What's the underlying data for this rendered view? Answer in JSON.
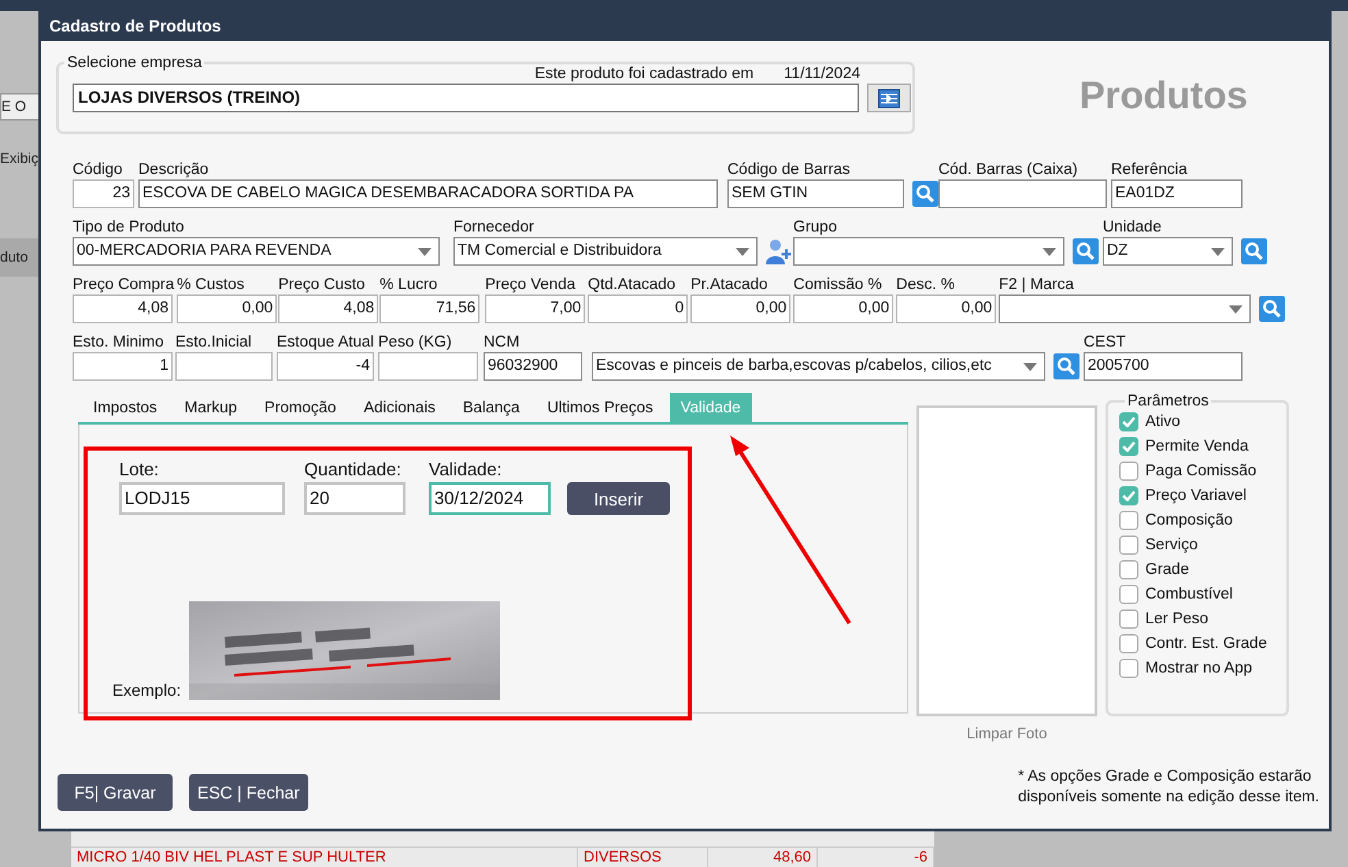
{
  "background": {
    "side_labels": [
      "E O",
      "Exibiç",
      "duto"
    ],
    "rows": [
      {
        "cells": [
          "MICRO 1/40 BIV HEL PLAST E SUP HULTER",
          "DIVERSOS",
          "48,60",
          "-6"
        ]
      }
    ]
  },
  "window": {
    "title": "Cadastro de Produtos"
  },
  "company": {
    "legend": "Selecione empresa",
    "registered_label": "Este produto foi cadastrado em",
    "registered_date": "11/11/2024",
    "value": "LOJAS DIVERSOS (TREINO)"
  },
  "heading": "Produtos",
  "field_rows": [
    [
      {
        "label": "Código",
        "value": "23",
        "kind": "number"
      },
      {
        "label": "Descrição",
        "value": "ESCOVA DE CABELO MAGICA DESEMBARACADORA SORTIDA PA",
        "kind": "text"
      },
      {
        "label": "Código de Barras",
        "value": "SEM GTIN",
        "kind": "text",
        "search": true
      },
      {
        "label": "Cód. Barras (Caixa)",
        "kind": "text"
      },
      {
        "label": "Referência",
        "value": "EA01DZ",
        "kind": "text"
      }
    ],
    [
      {
        "label": "Tipo de Produto",
        "value": "00-MERCADORIA PARA REVENDA",
        "kind": "dropdown"
      },
      {
        "label": "Fornecedor",
        "value": "TM Comercial e Distribuidora",
        "kind": "dropdown",
        "add_person": true
      },
      {
        "label": "Grupo",
        "kind": "dropdown",
        "search": true
      },
      {
        "label": "Unidade",
        "value": "DZ",
        "kind": "dropdown",
        "search": true
      }
    ],
    [
      {
        "label": "Preço Compra",
        "value": "4,08",
        "kind": "number"
      },
      {
        "label": "% Custos",
        "value": "0,00",
        "kind": "number"
      },
      {
        "label": "Preço Custo",
        "value": "4,08",
        "kind": "number"
      },
      {
        "label": "% Lucro",
        "value": "71,56",
        "kind": "number"
      },
      {
        "label": "Preço Venda",
        "value": "7,00",
        "kind": "number"
      },
      {
        "label": "Qtd.Atacado",
        "value": "0",
        "kind": "number"
      },
      {
        "label": "Pr.Atacado",
        "value": "0,00",
        "kind": "number"
      },
      {
        "label": "Comissão %",
        "value": "0,00",
        "kind": "number"
      },
      {
        "label": "Desc. %",
        "value": "0,00",
        "kind": "number"
      },
      {
        "label": "F2 | Marca",
        "kind": "dropdown",
        "search": true
      }
    ],
    [
      {
        "label": "Esto. Minimo",
        "value": "1",
        "kind": "number"
      },
      {
        "label": "Esto.Inicial",
        "kind": "number"
      },
      {
        "label": "Estoque Atual",
        "value": "-4",
        "kind": "number"
      },
      {
        "label": "Peso (KG)",
        "kind": "number"
      },
      {
        "label": "NCM",
        "value": "96032900",
        "kind": "text"
      },
      {
        "value": "Escovas e pinceis de barba,escovas p/cabelos, cilios,etc",
        "kind": "dropdown",
        "search": true
      },
      {
        "label": "CEST",
        "value": "2005700",
        "kind": "text"
      }
    ]
  ],
  "tabs": [
    {
      "label": "Impostos",
      "selected": false
    },
    {
      "label": "Markup",
      "selected": false
    },
    {
      "label": "Promoção",
      "selected": false
    },
    {
      "label": "Adicionais",
      "selected": false
    },
    {
      "label": "Balança",
      "selected": false
    },
    {
      "label": "Ultimos Preços",
      "selected": false
    },
    {
      "label": "Validade",
      "selected": true
    }
  ],
  "validade": {
    "fields": [
      {
        "label": "Lote:",
        "value": "LODJ15",
        "focused": false
      },
      {
        "label": "Quantidade:",
        "value": "20",
        "focused": false
      },
      {
        "label": "Validade:",
        "value": "30/12/2024",
        "focused": true
      }
    ],
    "button": "Inserir",
    "example_label": "Exemplo:"
  },
  "photo": {
    "clear_label": "Limpar Foto"
  },
  "params": {
    "legend": "Parâmetros",
    "items": [
      {
        "label": "Ativo",
        "checked": true
      },
      {
        "label": "Permite Venda",
        "checked": true
      },
      {
        "label": "Paga Comissão",
        "checked": false
      },
      {
        "label": "Preço Variavel",
        "checked": true
      },
      {
        "label": "Composição",
        "checked": false
      },
      {
        "label": "Serviço",
        "checked": false
      },
      {
        "label": "Grade",
        "checked": false
      },
      {
        "label": "Combustível",
        "checked": false
      },
      {
        "label": "Ler Peso",
        "checked": false
      },
      {
        "label": "Contr. Est. Grade",
        "checked": false
      },
      {
        "label": "Mostrar no App",
        "checked": false
      }
    ]
  },
  "buttons": [
    "F5| Gravar",
    "ESC | Fechar"
  ],
  "note": "* As opções Grade e Composição estarão\ndisponíveis somente na edição desse item."
}
